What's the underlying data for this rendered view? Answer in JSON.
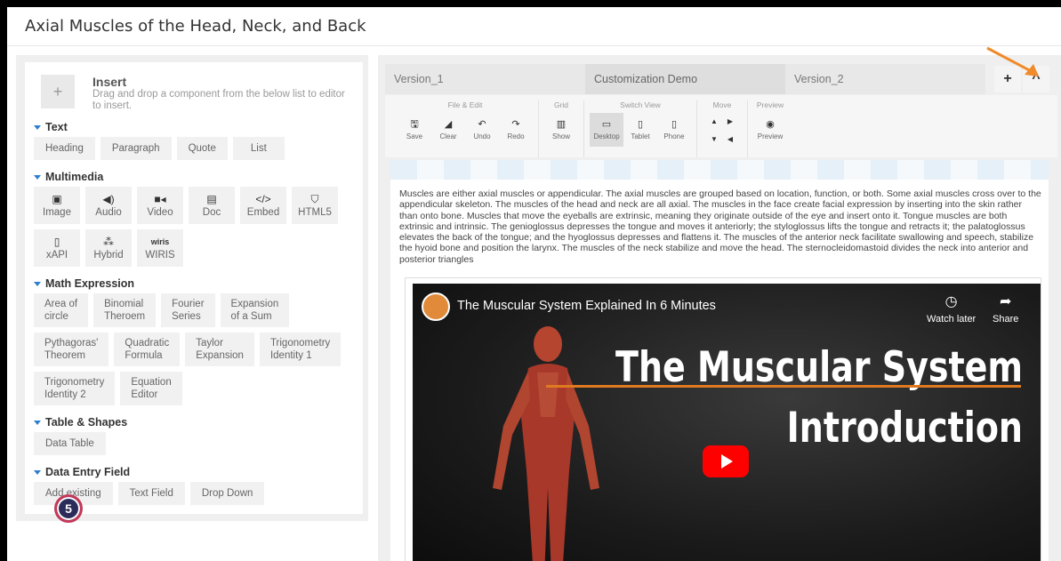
{
  "page": {
    "title": "Axial Muscles of the Head, Neck, and Back"
  },
  "insert": {
    "title": "Insert",
    "description": "Drag and drop a component from the below list to editor to insert."
  },
  "sections": {
    "text": {
      "label": "Text",
      "items": [
        "Heading",
        "Paragraph",
        "Quote",
        "List"
      ]
    },
    "multimedia": {
      "label": "Multimedia",
      "items": [
        {
          "label": "Image",
          "icon": "image-icon"
        },
        {
          "label": "Audio",
          "icon": "speaker-icon"
        },
        {
          "label": "Video",
          "icon": "video-camera-icon"
        },
        {
          "label": "Doc",
          "icon": "document-icon"
        },
        {
          "label": "Embed",
          "icon": "code-icon"
        },
        {
          "label": "HTML5",
          "icon": "html5-icon"
        },
        {
          "label": "xAPI",
          "icon": "xapi-file-icon"
        },
        {
          "label": "Hybrid",
          "icon": "hybrid-icon"
        },
        {
          "label": "WIRIS",
          "icon": "wiris-icon"
        }
      ]
    },
    "math": {
      "label": "Math Expression",
      "items": [
        [
          "Area of",
          "circle"
        ],
        [
          "Binomial",
          "Theroem"
        ],
        [
          "Fourier",
          "Series"
        ],
        [
          "Expansion",
          "of a Sum"
        ],
        [
          "Pythagoras'",
          "Theorem"
        ],
        [
          "Quadratic",
          "Formula"
        ],
        [
          "Taylor",
          "Expansion"
        ],
        [
          "Trigonometry",
          "Identity 1"
        ],
        [
          "Trigonometry",
          "Identity 2"
        ],
        [
          "Equation",
          "Editor"
        ]
      ]
    },
    "table": {
      "label": "Table & Shapes",
      "items": [
        "Data Table"
      ]
    },
    "data_entry": {
      "label": "Data Entry Field",
      "items": [
        "Add existing",
        "Text Field",
        "Drop Down"
      ]
    }
  },
  "step_badge": "5",
  "tabs": [
    "Version_1",
    "Customization Demo",
    "Version_2"
  ],
  "toolbar": {
    "groups": {
      "file_edit": {
        "label": "File & Edit",
        "buttons": [
          "Save",
          "Clear",
          "Undo",
          "Redo"
        ]
      },
      "grid": {
        "label": "Grid",
        "buttons": [
          "Show"
        ]
      },
      "switch_view": {
        "label": "Switch View",
        "buttons": [
          "Desktop",
          "Tablet",
          "Phone"
        ]
      },
      "move": {
        "label": "Move"
      },
      "preview": {
        "label": "Preview",
        "buttons": [
          "Preview"
        ]
      }
    }
  },
  "editor": {
    "paragraph": "Muscles are either axial muscles or appendicular. The axial muscles are grouped based on location, function, or both. Some axial muscles cross over to the appendicular skeleton. The muscles of the head and neck are all axial. The muscles in the face create facial expression by inserting into the skin rather than onto bone. Muscles that move the eyeballs are extrinsic, meaning they originate outside of the eye and insert onto it. Tongue muscles are both extrinsic and intrinsic. The genioglossus depresses the tongue and moves it anteriorly; the styloglossus lifts the tongue and retracts it; the palatoglossus elevates the back of the tongue; and the hyoglossus depresses and flattens it. The muscles of the anterior neck facilitate swallowing and speech, stabilize the hyoid bone and position the larynx. The muscles of the neck stabilize and move the head.  The sternocleidomastoid divides the neck into anterior and posterior triangles",
    "video": {
      "title": "The Muscular System Explained In 6 Minutes",
      "watch_later": "Watch later",
      "share": "Share",
      "headline1": "The Muscular System",
      "headline2": "Introduction"
    }
  },
  "colors": {
    "accent": "#2d7fd0",
    "annotation": "#f08a2a",
    "play": "#ff0000"
  }
}
